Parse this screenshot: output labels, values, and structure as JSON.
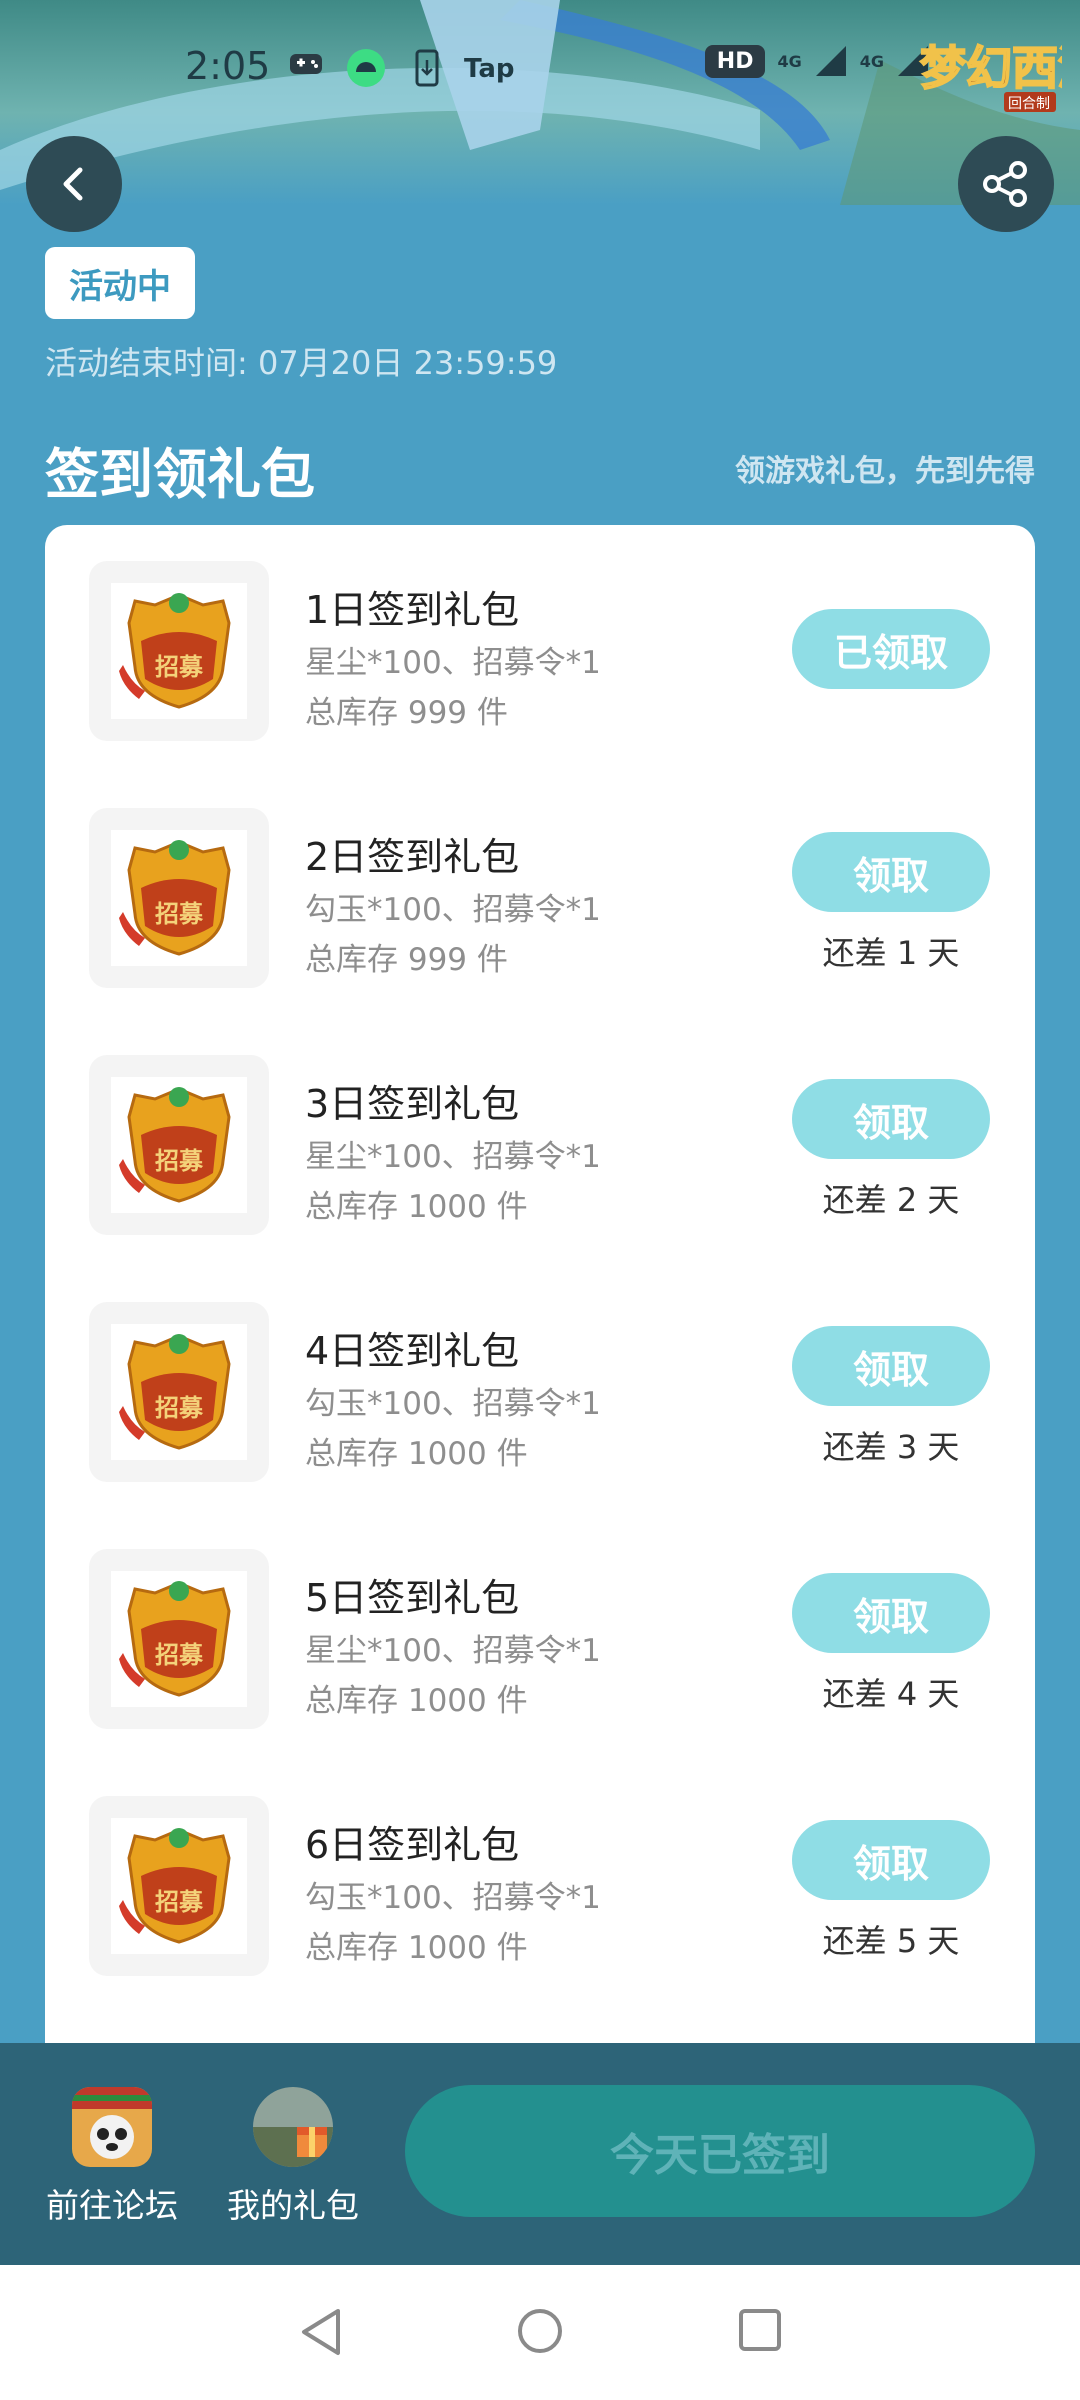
{
  "status_bar": {
    "time": "2:05",
    "tap_label": "Tap",
    "hd_label": "HD",
    "network_labels": [
      "4G",
      "4G"
    ]
  },
  "header": {
    "back_icon": "chevron-left-icon",
    "share_icon": "share-icon",
    "game_logo_text": "梦幻西游",
    "game_logo_sub": "回合制"
  },
  "activity": {
    "status_tag": "活动中",
    "end_time": "活动结束时间: 07月20日 23:59:59"
  },
  "section": {
    "title": "签到领礼包",
    "subtitle": "领游戏礼包，先到先得"
  },
  "packages": [
    {
      "title": "1日签到礼包",
      "desc": "星尘*100、招募令*1",
      "stock": "总库存 999 件",
      "button": "已领取",
      "remain": ""
    },
    {
      "title": "2日签到礼包",
      "desc": "勾玉*100、招募令*1",
      "stock": "总库存 999 件",
      "button": "领取",
      "remain": "还差 1 天"
    },
    {
      "title": "3日签到礼包",
      "desc": "星尘*100、招募令*1",
      "stock": "总库存 1000 件",
      "button": "领取",
      "remain": "还差 2 天"
    },
    {
      "title": "4日签到礼包",
      "desc": "勾玉*100、招募令*1",
      "stock": "总库存 1000 件",
      "button": "领取",
      "remain": "还差 3 天"
    },
    {
      "title": "5日签到礼包",
      "desc": "星尘*100、招募令*1",
      "stock": "总库存 1000 件",
      "button": "领取",
      "remain": "还差 4 天"
    },
    {
      "title": "6日签到礼包",
      "desc": "勾玉*100、招募令*1",
      "stock": "总库存 1000 件",
      "button": "领取",
      "remain": "还差 5 天"
    }
  ],
  "package_badge_text": "招募",
  "bottom_bar": {
    "forum_label": "前往论坛",
    "gifts_label": "我的礼包",
    "signed_label": "今天已签到"
  },
  "colors": {
    "page_bg": "#4a9fc4",
    "accent": "#3d9ac0",
    "claim_button": "#8fdde5",
    "bottom_bar": "#2d6478",
    "signed_button": "#23908f"
  }
}
